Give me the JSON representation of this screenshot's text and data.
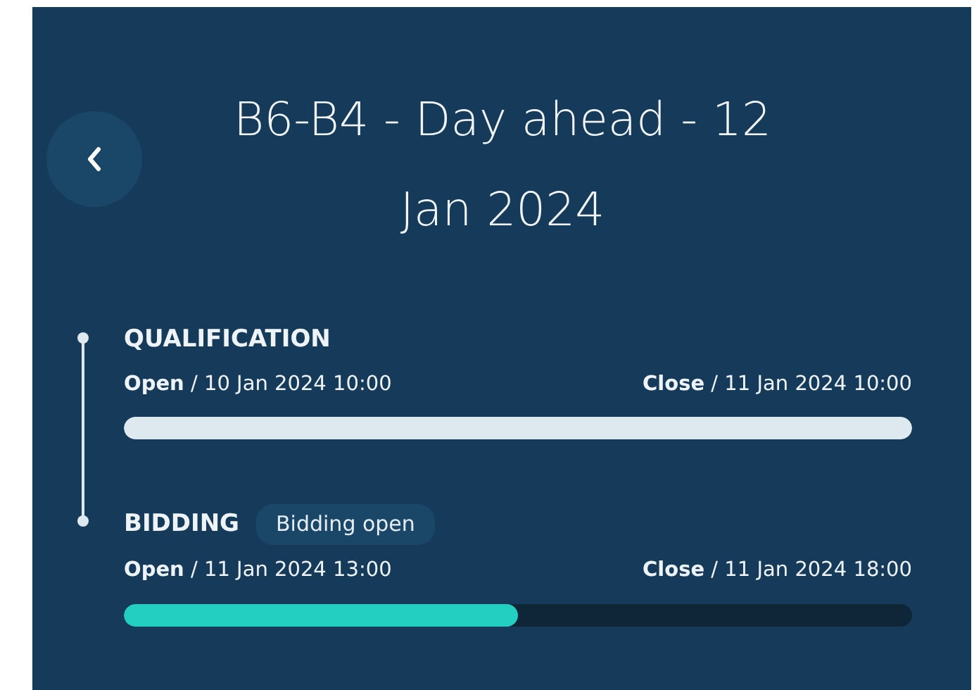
{
  "header": {
    "title": "B6-B4 - Day ahead - 12 Jan 2024"
  },
  "stages": [
    {
      "name": "QUALIFICATION",
      "open": "**Open** / 10 Jan 2024 10:00",
      "close": "**Close** / 11 Jan 2024 10:00",
      "completed": true,
      "level": 1
    },
    {
      "name": "BIDDING",
      "badge": "Bidding open",
      "open": "**Open** / 11 Jan 2024 13:00",
      "close": "**Close** / 11 Jan 2024 18:00",
      "completed": false,
      "level": 0.5
    }
  ]
}
